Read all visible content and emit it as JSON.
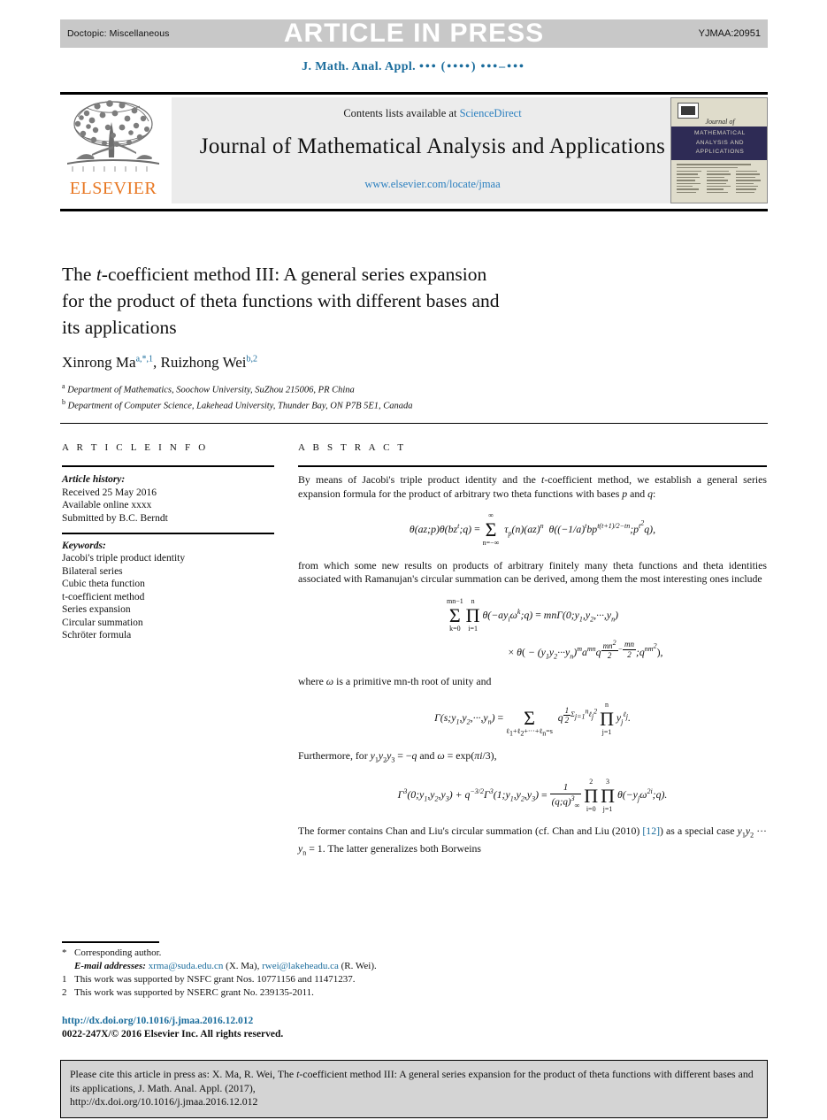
{
  "press_bar": {
    "doctopic": "Doctopic: Miscellaneous",
    "article_in_press": "ARTICLE IN PRESS",
    "article_id": "YJMAA:20951"
  },
  "running_head": {
    "journal_abbrev": "J. Math. Anal. Appl.",
    "volume_dots": "•••",
    "year_dots": "(••••)",
    "pages_dots": "•••–•••"
  },
  "masthead": {
    "contents_prefix": "Contents lists available at",
    "sciencedirect": "ScienceDirect",
    "journal_name": "Journal of Mathematical Analysis and Applications",
    "journal_url": "www.elsevier.com/locate/jmaa",
    "publisher": "ELSEVIER",
    "cover": {
      "script_word": "Journal of",
      "band_line1": "MATHEMATICAL",
      "band_line2": "ANALYSIS AND",
      "band_line3": "APPLICATIONS"
    }
  },
  "article": {
    "title_line1_a": "The ",
    "title_line1_i": "t",
    "title_line1_b": "-coefficient method III: A general series expansion",
    "title_line2": "for the product of theta functions with different bases and",
    "title_line3": "its applications",
    "authors": [
      {
        "name": "Xinrong Ma",
        "marks": "a,*,1"
      },
      {
        "name": "Ruizhong Wei",
        "marks": "b,2"
      }
    ],
    "affiliations": [
      {
        "mark": "a",
        "text": "Department of Mathematics, Soochow University, SuZhou 215006, PR China"
      },
      {
        "mark": "b",
        "text": "Department of Computer Science, Lakehead University, Thunder Bay, ON P7B 5E1, Canada"
      }
    ]
  },
  "article_info": {
    "heading": "A R T I C L E   I N F O",
    "history_label": "Article history:",
    "history": [
      "Received 25 May 2016",
      "Available online xxxx",
      "Submitted by B.C. Berndt"
    ],
    "keywords_label": "Keywords:",
    "keywords": [
      "Jacobi's triple product identity",
      "Bilateral series",
      "Cubic theta function",
      "t-coefficient method",
      "Series expansion",
      "Circular summation",
      "Schröter formula"
    ]
  },
  "abstract": {
    "heading": "A B S T R A C T",
    "para1": "By means of Jacobi's triple product identity and the t-coefficient method, we establish a general series expansion formula for the product of arbitrary two theta functions with bases p and q:",
    "equation1": "θ(az;p)θ(bz^t;q) = Σ_{n=-∞}^{∞} τ_p(n)(az)^n θ((−1/a)^t b p^{t(t+1)/2−tn}; p^{t²}q),",
    "para2": "from which some new results on products of arbitrary finitely many theta functions and theta identities associated with Ramanujan's circular summation can be derived, among them the most interesting ones include",
    "equation2_line1": "Σ_{k=0}^{mn−1} ∏_{i=1}^{n} θ(−a y_i ω^k; q) = mn Γ(0; y₁, y₂, ⋯ , y_n)",
    "equation2_line2": "× θ( − (y₁y₂ ⋯ y_n)^m a^{mn} q^{mn²/2 − mn/2}; q^{nm²} ),",
    "para3": "where ω is a primitive mn-th root of unity and",
    "equation3": "Γ(s; y₁, y₂, ⋯ , y_n) = Σ_{ℓ₁+ℓ₂+⋯+ℓ_n=s} q^{½Σ_{j=1}^{n} ℓ_j²} ∏_{j=1}^{n} y_j^{ℓ_j}.",
    "para4": "Furthermore, for y₁y₂y₃ = −q and ω = exp(πi/3),",
    "equation4": "Γ³(0; y₁, y₂, y₃) + q^{−3/2} Γ³(1; y₁, y₂, y₃) = 1/(q;q)³_∞ ∏_{i=0}^{2} ∏_{j=1}^{3} θ(−y_j ω^{2i}; q).",
    "para5_a": "The former contains Chan and Liu's circular summation (cf. Chan and Liu (2010) ",
    "para5_ref": "[12]",
    "para5_b": ") as a special case y₁y₂ ⋯ y_n = 1. The latter generalizes both Borweins"
  },
  "footnotes": {
    "corresponding_marker": "*",
    "corresponding": "Corresponding author.",
    "email_label": "E-mail addresses:",
    "email1": "xrma@suda.edu.cn",
    "email1_owner": "(X. Ma),",
    "email2": "rwei@lakeheadu.ca",
    "email2_owner": "(R. Wei).",
    "note1_marker": "1",
    "note1": "This work was supported by NSFC grant Nos. 10771156 and 11471237.",
    "note2_marker": "2",
    "note2": "This work was supported by NSERC grant No. 239135-2011."
  },
  "doi": "http://dx.doi.org/10.1016/j.jmaa.2016.12.012",
  "copyright": "0022-247X/© 2016 Elsevier Inc. All rights reserved.",
  "cite_box": {
    "prefix": "Please cite this article in press as: X. Ma, R. Wei, The ",
    "italic": "t",
    "middle": "-coefficient method III: A general series expansion for the product of theta functions with different bases and its applications, J. Math. Anal. Appl. (2017),",
    "url": "http://dx.doi.org/10.1016/j.jmaa.2016.12.012"
  },
  "colors": {
    "link_blue": "#2a7fbf",
    "heading_blue": "#1a6c9c",
    "elsevier_orange": "#e87722",
    "press_gray": "#c8c8c8",
    "panel_gray": "#ececec",
    "cover_navy": "#2e2b55",
    "cite_gray": "#d4d4d4"
  }
}
